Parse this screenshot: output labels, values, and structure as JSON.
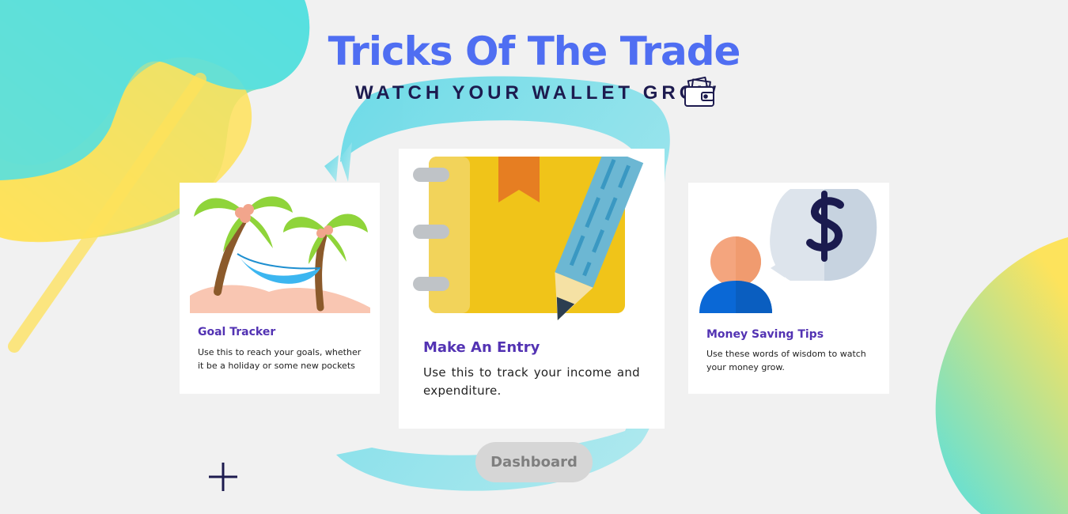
{
  "header": {
    "title": "Tricks Of The Trade",
    "subtitle": "WATCH YOUR WALLET GROW",
    "subtitle_icon": "wallet-icon"
  },
  "cards": [
    {
      "title": "Goal Tracker",
      "text": "Use this to reach your goals, whether it be a holiday or some new pockets",
      "image": "palm-trees-hammock-illustration"
    },
    {
      "title": "Make An Entry",
      "text": "Use this to track your income and expenditure.",
      "image": "notebook-pencil-illustration"
    },
    {
      "title": "Money Saving Tips",
      "text": "Use these words of wisdom to watch your money grow.",
      "image": "person-dollar-speech-bubble-illustration"
    }
  ],
  "actions": {
    "dashboard_label": "Dashboard",
    "add_icon": "plus-icon"
  },
  "colors": {
    "title": "#4f6ef2",
    "subtitle": "#1d1b4f",
    "card_title": "#5333b3",
    "button_bg": "#d6d6d6",
    "button_text": "#7f7f7f",
    "brush_cyan": "#7fdde5",
    "blob_yellow": "#ffe25a"
  }
}
